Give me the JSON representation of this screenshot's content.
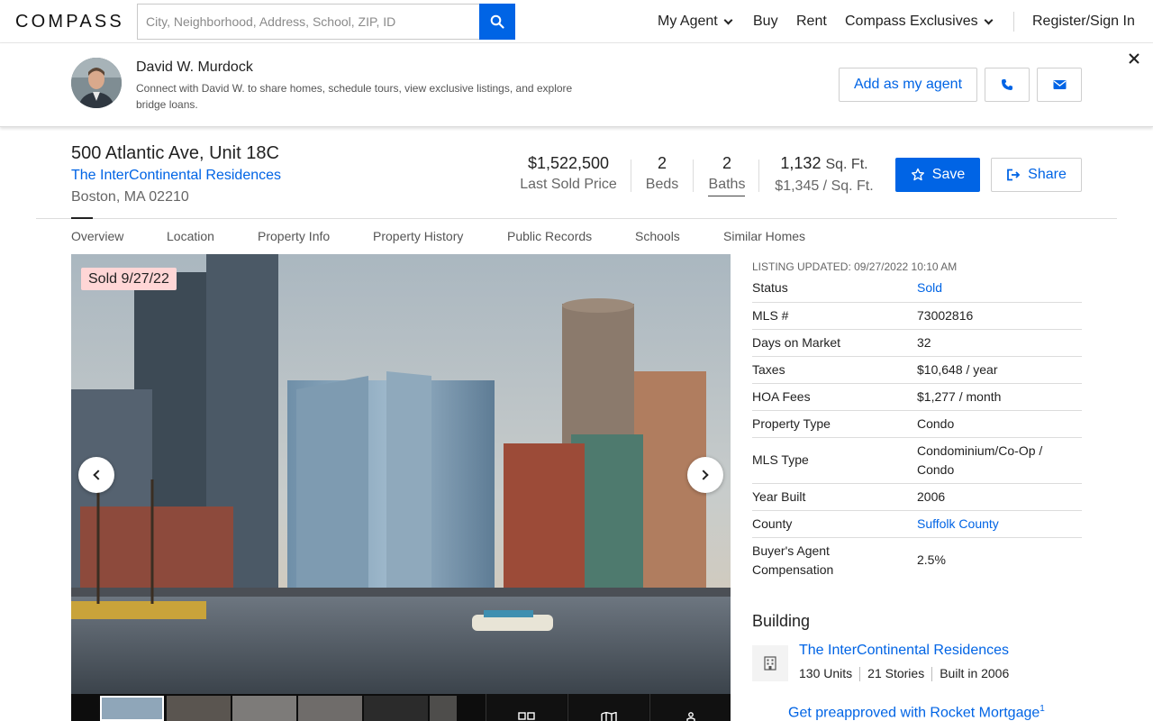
{
  "header": {
    "logo": "COMPASS",
    "search_placeholder": "City, Neighborhood, Address, School, ZIP, ID",
    "nav": {
      "my_agent": "My Agent",
      "buy": "Buy",
      "rent": "Rent",
      "exclusives": "Compass Exclusives",
      "register": "Register/Sign In"
    }
  },
  "agent_banner": {
    "name": "David W. Murdock",
    "description": "Connect with David W. to share homes, schedule tours, view exclusive listings, and explore bridge loans.",
    "add_button": "Add as my agent"
  },
  "listing": {
    "address": "500 Atlantic Ave, Unit 18C",
    "building": "The InterContinental Residences",
    "city": "Boston, MA 02210",
    "price": "$1,522,500",
    "price_label": "Last Sold Price",
    "beds": "2",
    "beds_label": "Beds",
    "baths": "2",
    "baths_label": "Baths",
    "sqft": "1,132",
    "sqft_unit": "Sq. Ft.",
    "price_per_sqft": "$1,345 / Sq. Ft.",
    "save_label": "Save",
    "share_label": "Share",
    "sold_badge": "Sold 9/27/22"
  },
  "tabs": [
    "Overview",
    "Location",
    "Property Info",
    "Property History",
    "Public Records",
    "Schools",
    "Similar Homes"
  ],
  "details": {
    "updated": "LISTING UPDATED: 09/27/2022 10:10 AM",
    "rows": [
      {
        "key": "Status",
        "value": "Sold",
        "link": true
      },
      {
        "key": "MLS #",
        "value": "73002816",
        "link": false
      },
      {
        "key": "Days on Market",
        "value": "32",
        "link": false
      },
      {
        "key": "Taxes",
        "value": "$10,648 / year",
        "link": false
      },
      {
        "key": "HOA Fees",
        "value": "$1,277 / month",
        "link": false
      },
      {
        "key": "Property Type",
        "value": "Condo",
        "link": false
      },
      {
        "key": "MLS Type",
        "value": "Condominium/Co-Op / Condo",
        "link": false
      },
      {
        "key": "Year Built",
        "value": "2006",
        "link": false
      },
      {
        "key": "County",
        "value": "Suffolk County",
        "link": true
      },
      {
        "key": "Buyer's Agent Compensation",
        "value": "2.5%",
        "link": false
      }
    ]
  },
  "building_section": {
    "heading": "Building",
    "name": "The InterContinental Residences",
    "units": "130 Units",
    "stories": "21 Stories",
    "built": "Built in 2006"
  },
  "mortgage": {
    "text": "Get preapproved with Rocket Mortgage",
    "footnote": "1"
  },
  "colors": {
    "accent": "#0064e5",
    "sold_badge_bg": "#ffd6d6"
  }
}
